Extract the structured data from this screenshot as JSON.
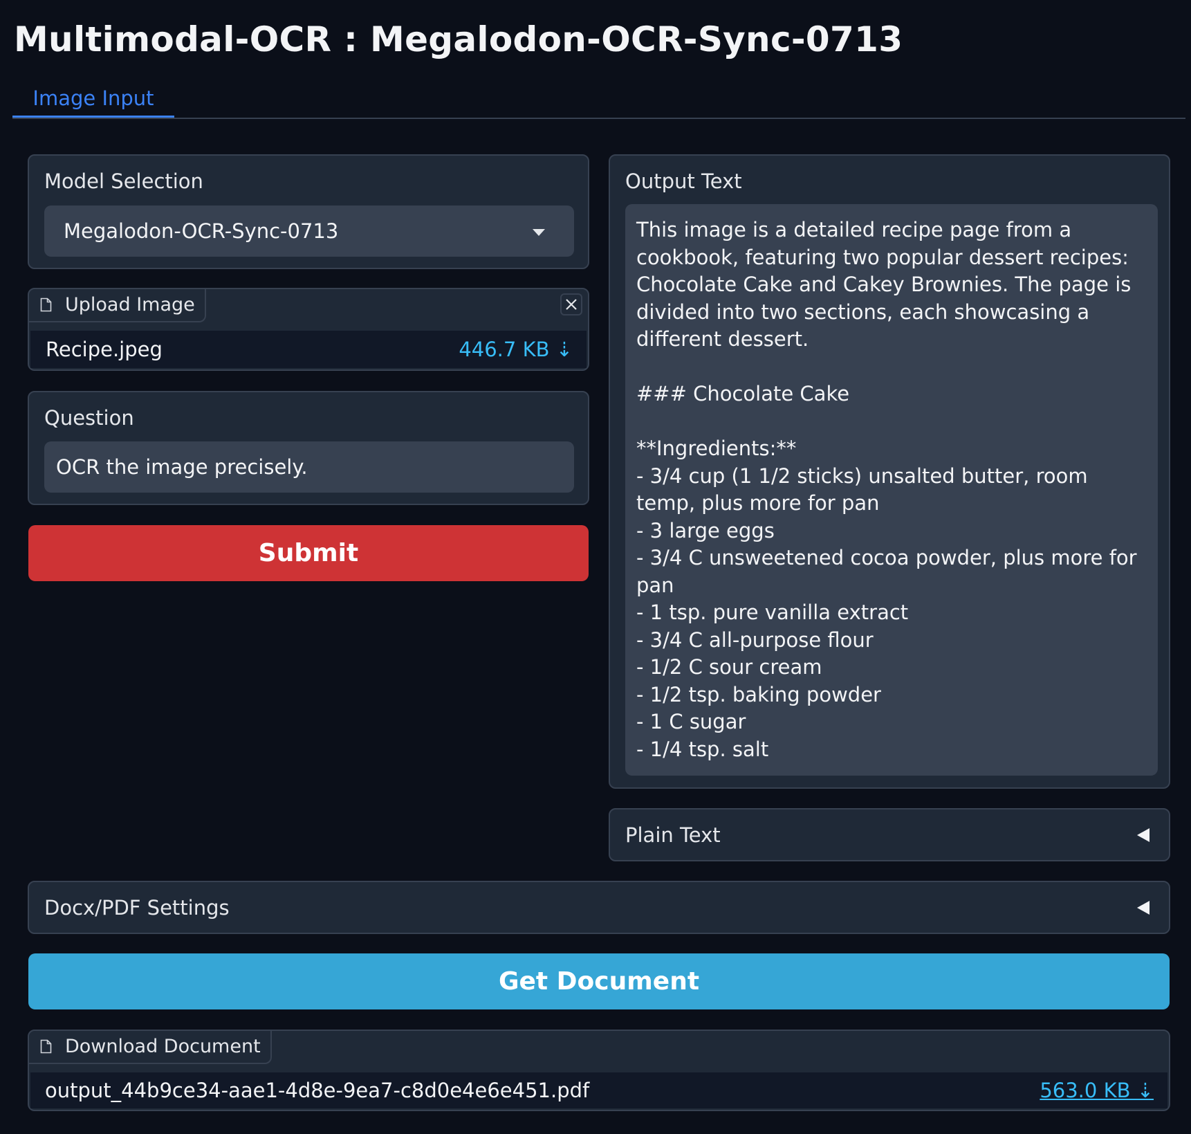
{
  "app": {
    "title": "Multimodal-OCR : Megalodon-OCR-Sync-0713"
  },
  "tabs": [
    {
      "label": "Image Input"
    }
  ],
  "model_selection": {
    "label": "Model Selection",
    "value": "Megalodon-OCR-Sync-0713"
  },
  "upload": {
    "label": "Upload Image",
    "filename": "Recipe.jpeg",
    "size": "446.7 KB ⇣"
  },
  "question": {
    "label": "Question",
    "value": "OCR the image precisely."
  },
  "submit": {
    "label": "Submit"
  },
  "output": {
    "label": "Output Text",
    "text": "This image is a detailed recipe page from a cookbook, featuring two popular dessert recipes: Chocolate Cake and Cakey Brownies. The page is divided into two sections, each showcasing a different dessert.\n\n### Chocolate Cake\n\n**Ingredients:**\n- 3/4 cup (1 1/2 sticks) unsalted butter, room temp, plus more for pan\n- 3 large eggs\n- 3/4 C unsweetened cocoa powder, plus more for pan\n- 1 tsp. pure vanilla extract\n- 3/4 C all-purpose flour\n- 1/2 C sour cream\n- 1/2 tsp. baking powder\n- 1 C sugar\n- 1/4 tsp. salt"
  },
  "plain_text": {
    "label": "Plain Text"
  },
  "docx_settings": {
    "label": "Docx/PDF Settings"
  },
  "get_document": {
    "label": "Get Document"
  },
  "download": {
    "label": "Download Document",
    "filename": "output_44b9ce34-aae1-4d8e-9ea7-c8d0e4e6e451.pdf",
    "size": "563.0 KB ⇣"
  },
  "colors": {
    "accent_blue": "#3b82f6",
    "submit_red": "#ce3335",
    "get_doc_blue": "#36a6d6",
    "link_cyan": "#38bdf8"
  },
  "icons": {
    "file": "file-icon",
    "close": "close-icon",
    "dropdown": "chevron-down-icon",
    "collapse": "triangle-left-icon"
  }
}
